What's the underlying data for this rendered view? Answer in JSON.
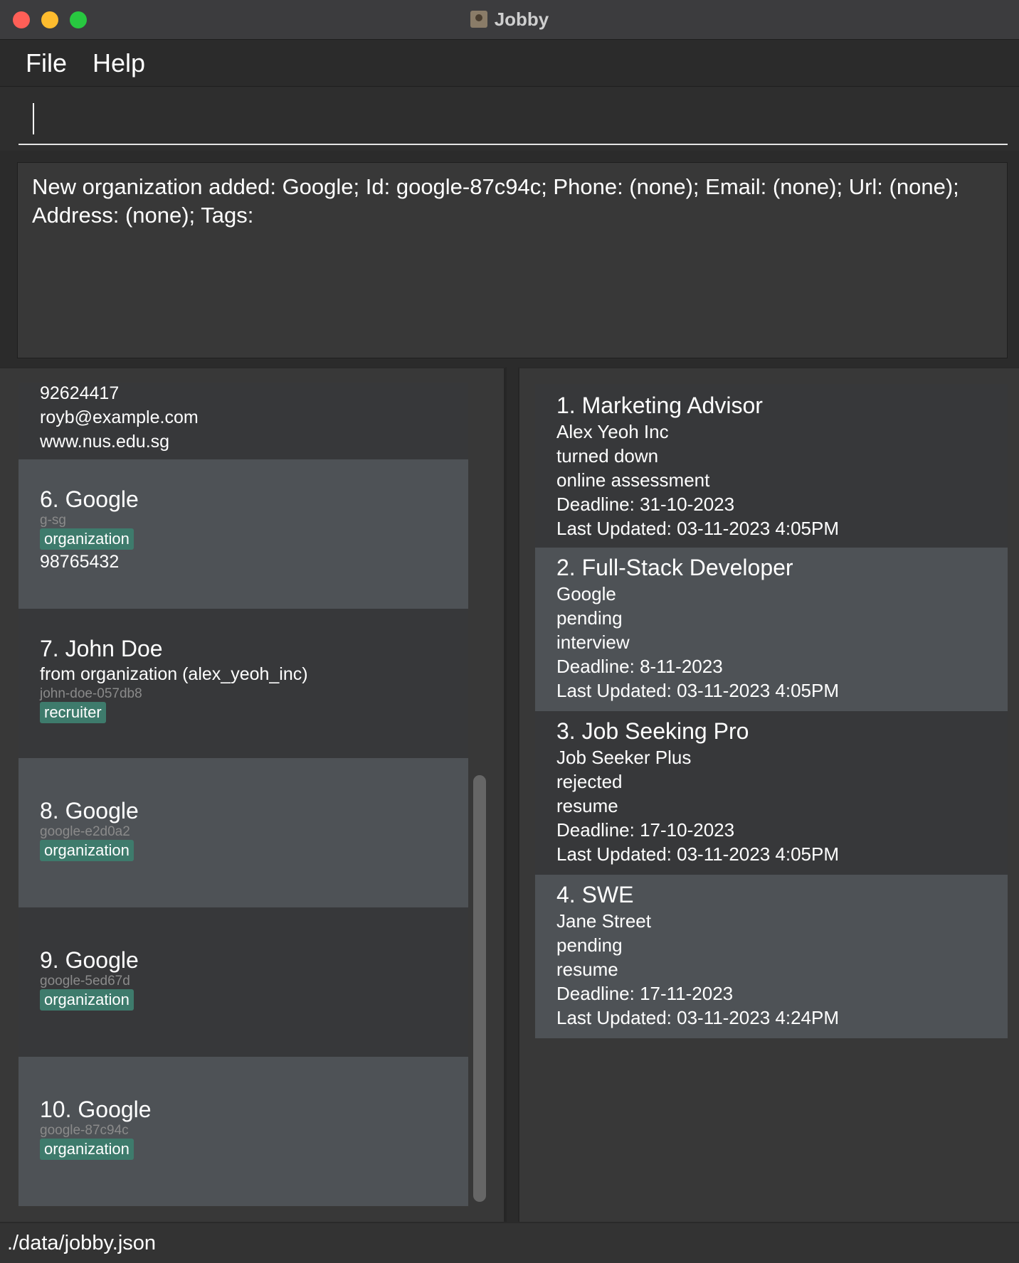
{
  "window": {
    "title": "Jobby"
  },
  "menu": {
    "file": "File",
    "help": "Help"
  },
  "command": {
    "value": ""
  },
  "result": {
    "text": "New organization added: Google; Id: google-87c94c; Phone: (none); Email: (none); Url: (none);\nAddress: (none); Tags:"
  },
  "contacts": {
    "partial": {
      "phone": "92624417",
      "email": "royb@example.com",
      "url": "www.nus.edu.sg"
    },
    "c6": {
      "title": "6.  Google",
      "id": "g-sg",
      "tag": "organization",
      "phone": "98765432"
    },
    "c7": {
      "title": "7.  John Doe",
      "from": "from organization (alex_yeoh_inc)",
      "id": "john-doe-057db8",
      "tag": "recruiter"
    },
    "c8": {
      "title": "8.  Google",
      "id": "google-e2d0a2",
      "tag": "organization"
    },
    "c9": {
      "title": "9.  Google",
      "id": "google-5ed67d",
      "tag": "organization"
    },
    "c10": {
      "title": "10.  Google",
      "id": "google-87c94c",
      "tag": "organization"
    }
  },
  "jobs": {
    "j1": {
      "title": "1.  Marketing Advisor",
      "company": "Alex Yeoh Inc",
      "status": "turned down",
      "stage": "online assessment",
      "deadline": "Deadline: 31-10-2023",
      "updated": "Last Updated: 03-11-2023 4:05PM"
    },
    "j2": {
      "title": "2.  Full-Stack Developer",
      "company": "Google",
      "status": "pending",
      "stage": "interview",
      "deadline": "Deadline: 8-11-2023",
      "updated": "Last Updated: 03-11-2023 4:05PM"
    },
    "j3": {
      "title": "3.  Job Seeking Pro",
      "company": "Job Seeker Plus",
      "status": "rejected",
      "stage": "resume",
      "deadline": "Deadline: 17-10-2023",
      "updated": "Last Updated: 03-11-2023 4:05PM"
    },
    "j4": {
      "title": "4.  SWE",
      "company": "Jane Street",
      "status": "pending",
      "stage": "resume",
      "deadline": "Deadline: 17-11-2023",
      "updated": "Last Updated: 03-11-2023 4:24PM"
    }
  },
  "status": {
    "path": "./data/jobby.json"
  },
  "colors": {
    "tag": "#3e7b6c",
    "card_light": "#4e5256",
    "card_dark": "#37383a",
    "background": "#2b2b2b"
  }
}
